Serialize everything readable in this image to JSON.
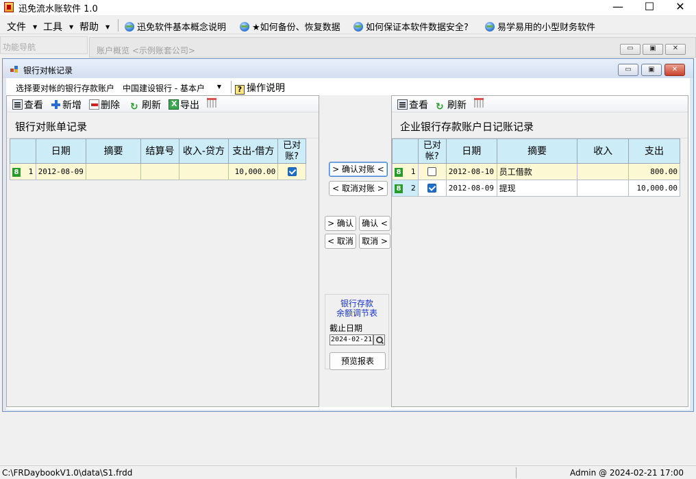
{
  "window": {
    "title": "迅免流水账软件 1.0",
    "min_icon": "—",
    "max_icon": "☐",
    "close_icon": "✕"
  },
  "menu": {
    "items": [
      {
        "label": "文件"
      },
      {
        "label": "工具"
      },
      {
        "label": "帮助"
      }
    ],
    "links": [
      {
        "label": "迅免软件基本概念说明"
      },
      {
        "label": "★如何备份、恢复数据"
      },
      {
        "label": "如何保证本软件数据安全?"
      },
      {
        "label": "易学易用的小型财务软件"
      }
    ]
  },
  "nav_panel": {
    "title": "功能导航"
  },
  "bg_window": {
    "title": "账户概览 <示例账套公司>"
  },
  "reconcile": {
    "title": "银行对帐记录",
    "account_label": "选择要对帐的银行存款账户",
    "account_value": "中国建设银行 - 基本户",
    "help_label": "操作说明",
    "left": {
      "toolbar": {
        "view": "查看",
        "add": "新增",
        "delete": "删除",
        "refresh": "刷新",
        "export": "导出"
      },
      "title": "银行对账单记录",
      "columns": [
        "日期",
        "摘要",
        "结算号",
        "收入-贷方",
        "支出-借方",
        "已对账?"
      ],
      "rows": [
        {
          "badge": "8",
          "n": "1",
          "date": "2012-08-09",
          "memo": "",
          "ref": "",
          "income": "",
          "expense": "10,000.00",
          "checked": true
        }
      ]
    },
    "right": {
      "toolbar": {
        "view": "查看",
        "refresh": "刷新"
      },
      "title": "企业银行存款账户日记账记录",
      "columns": [
        "已对帐?",
        "日期",
        "摘要",
        "收入",
        "支出"
      ],
      "rows": [
        {
          "badge": "8",
          "n": "1",
          "checked": false,
          "date": "2012-08-10",
          "memo": "员工借款",
          "income": "",
          "expense": "800.00"
        },
        {
          "badge": "8",
          "n": "2",
          "checked": true,
          "date": "2012-08-09",
          "memo": "提现",
          "income": "",
          "expense": "10,000.00"
        }
      ]
    },
    "middle": {
      "confirm_match": "> 确认对账 <",
      "cancel_match": "< 取消对账 >",
      "confirm_left": "> 确认",
      "confirm_right": "确认 <",
      "cancel_left": "< 取消",
      "cancel_right": "取消 >",
      "report_title_1": "银行存款",
      "report_title_2": "余额调节表",
      "cutoff_label": "截止日期",
      "cutoff_date": "2024-02-21",
      "preview": "预览报表"
    }
  },
  "status": {
    "path": "C:\\FRDaybookV1.0\\data\\S1.frdd",
    "user": "Admin @ 2024-02-21 17:00"
  }
}
